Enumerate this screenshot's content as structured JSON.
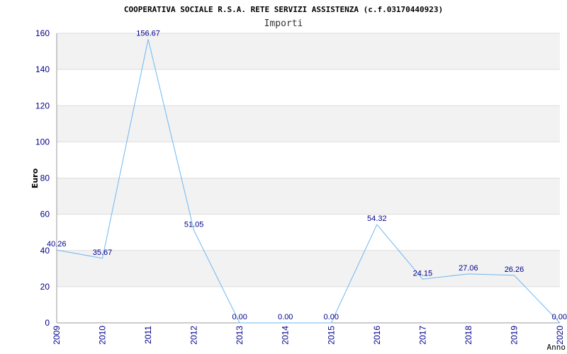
{
  "chart_data": {
    "type": "line",
    "title": "COOPERATIVA SOCIALE R.S.A. RETE SERVIZI ASSISTENZA (c.f.03170440923)",
    "subtitle": "Importi",
    "xlabel": "Anno",
    "ylabel": "Euro",
    "ylim": [
      0,
      160
    ],
    "yticks": [
      0,
      20,
      40,
      60,
      80,
      100,
      120,
      140,
      160
    ],
    "grid": true,
    "categories": [
      "2009",
      "2010",
      "2011",
      "2012",
      "2013",
      "2014",
      "2015",
      "2016",
      "2017",
      "2018",
      "2019",
      "2020"
    ],
    "series": [
      {
        "values": [
          40.26,
          35.67,
          156.67,
          51.05,
          0.0,
          0.0,
          0.0,
          54.32,
          24.15,
          27.06,
          26.26,
          0.0
        ],
        "labels": [
          "40.26",
          "35.67",
          "156.67",
          "51.05",
          "0.00",
          "0.00",
          "0.00",
          "54.32",
          "24.15",
          "27.06",
          "26.26",
          "0.00"
        ]
      }
    ],
    "colors": {
      "line": "#6fb7f0",
      "band": "#f2f2f2",
      "axis_text": "#00008b",
      "grid": "#dddddd"
    }
  }
}
